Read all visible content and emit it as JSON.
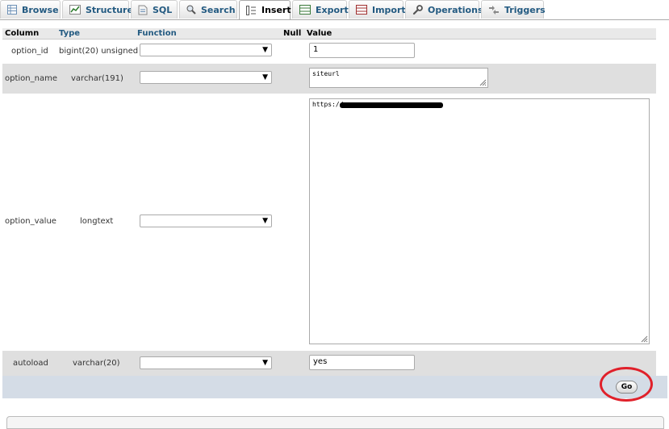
{
  "tabs": [
    {
      "label": "Browse",
      "icon": "browse-icon",
      "active": false
    },
    {
      "label": "Structure",
      "icon": "structure-icon",
      "active": false
    },
    {
      "label": "SQL",
      "icon": "sql-icon",
      "active": false
    },
    {
      "label": "Search",
      "icon": "search-icon",
      "active": false
    },
    {
      "label": "Insert",
      "icon": "insert-icon",
      "active": true
    },
    {
      "label": "Export",
      "icon": "export-icon",
      "active": false
    },
    {
      "label": "Import",
      "icon": "import-icon",
      "active": false
    },
    {
      "label": "Operations",
      "icon": "wrench-icon",
      "active": false
    },
    {
      "label": "Triggers",
      "icon": "triggers-icon",
      "active": false
    }
  ],
  "columns": {
    "column": "Column",
    "type": "Type",
    "function": "Function",
    "null": "Null",
    "value": "Value"
  },
  "rows": [
    {
      "column": "option_id",
      "type": "bigint(20) unsigned",
      "function": "",
      "value": "1"
    },
    {
      "column": "option_name",
      "type": "varchar(191)",
      "function": "",
      "value": "siteurl"
    },
    {
      "column": "option_value",
      "type": "longtext",
      "function": "",
      "value": "https://"
    },
    {
      "column": "autoload",
      "type": "varchar(20)",
      "function": "",
      "value": "yes"
    }
  ],
  "footer": {
    "go_label": "Go"
  },
  "colors": {
    "tab_text": "#235a81",
    "row_shade": "#dfdfdf",
    "footer_bg": "#d4dce6",
    "highlight_ring": "#e0202a"
  }
}
